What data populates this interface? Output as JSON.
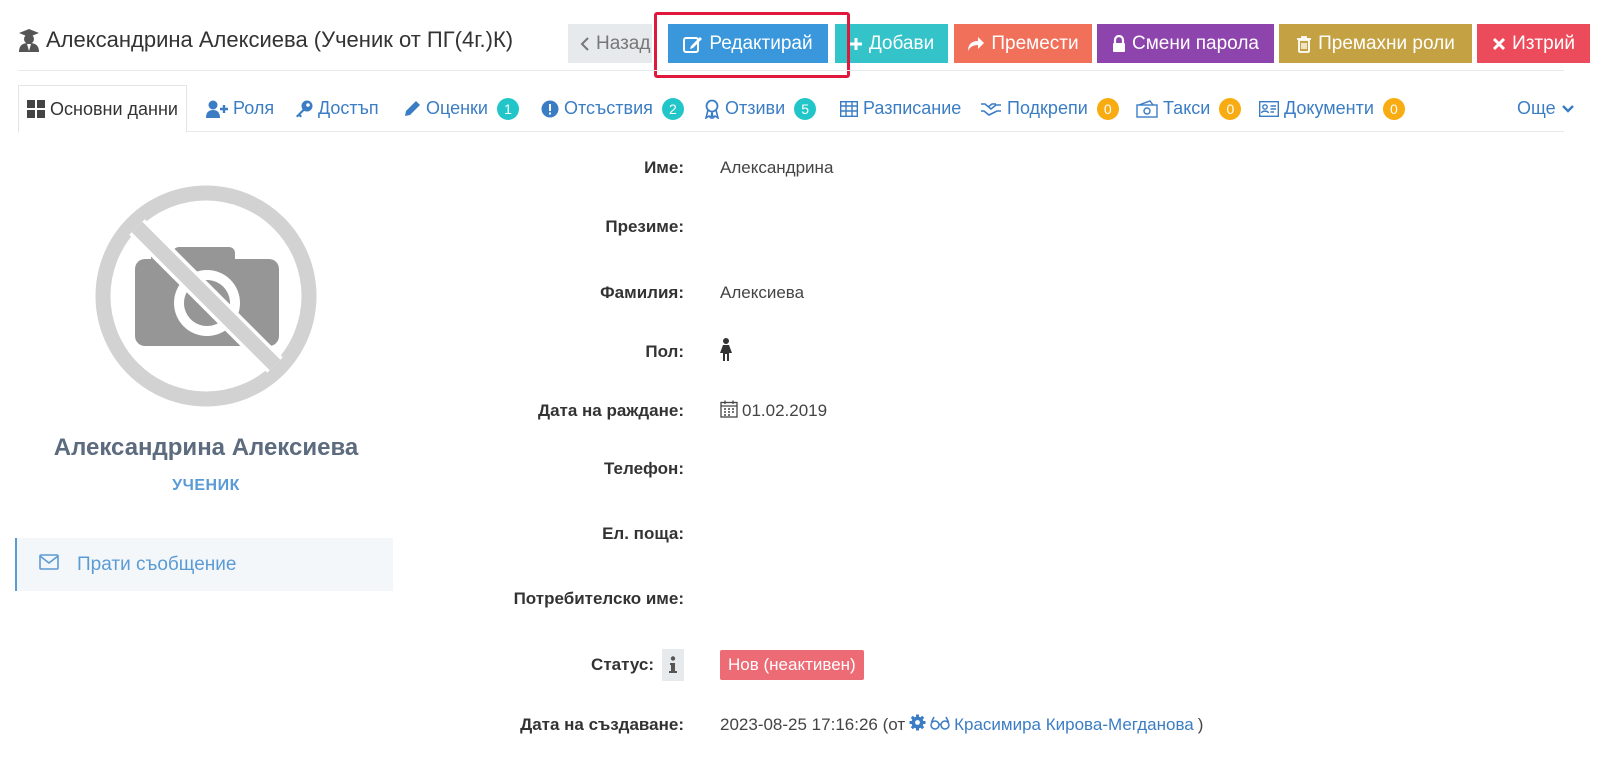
{
  "header": {
    "title": "Александрина Алексиева (Ученик от ПГ(4г.)К)",
    "buttons": {
      "back": "Назад",
      "edit": "Редактирай",
      "add": "Добави",
      "move": "Премести",
      "change_password": "Смени парола",
      "remove_roles": "Премахни роли",
      "delete": "Изтрий"
    }
  },
  "tabs": [
    {
      "label": "Основни данни"
    },
    {
      "label": "Роля"
    },
    {
      "label": "Достъп"
    },
    {
      "label": "Оценки",
      "badge": "1"
    },
    {
      "label": "Отсъствия",
      "badge": "2"
    },
    {
      "label": "Отзиви",
      "badge": "5"
    },
    {
      "label": "Разписание"
    },
    {
      "label": "Подкрепи",
      "badge": "0"
    },
    {
      "label": "Такси",
      "badge": "0"
    },
    {
      "label": "Документи",
      "badge": "0"
    },
    {
      "label": "Още"
    }
  ],
  "profile": {
    "name": "Александрина Алексиева",
    "role": "УЧЕНИК",
    "send_message": "Прати съобщение"
  },
  "details": {
    "first_name": {
      "label": "Име:",
      "value": "Александрина"
    },
    "middle_name": {
      "label": "Презиме:",
      "value": ""
    },
    "last_name": {
      "label": "Фамилия:",
      "value": "Алексиева"
    },
    "gender": {
      "label": "Пол:"
    },
    "birth_date": {
      "label": "Дата на раждане:",
      "value": "01.02.2019"
    },
    "phone": {
      "label": "Телефон:",
      "value": ""
    },
    "email": {
      "label": "Ел. поща:",
      "value": ""
    },
    "username": {
      "label": "Потребителско име:",
      "value": ""
    },
    "status": {
      "label": "Статус:",
      "value": "Нов (неактивен)"
    },
    "created": {
      "label": "Дата на създаване:",
      "value": "2023-08-25 17:16:26 (от",
      "creator": "Красимира Кирова-Мегданова",
      "suffix": ")"
    }
  },
  "colors": {
    "edit": "#3a97db",
    "add": "#33c3c9",
    "move": "#f0705a",
    "password": "#8e44ad",
    "roles": "#c4a244",
    "delete": "#ec4b5b",
    "link": "#3b7dc4",
    "status": "#ed6b75",
    "highlight": "#e0193c"
  }
}
